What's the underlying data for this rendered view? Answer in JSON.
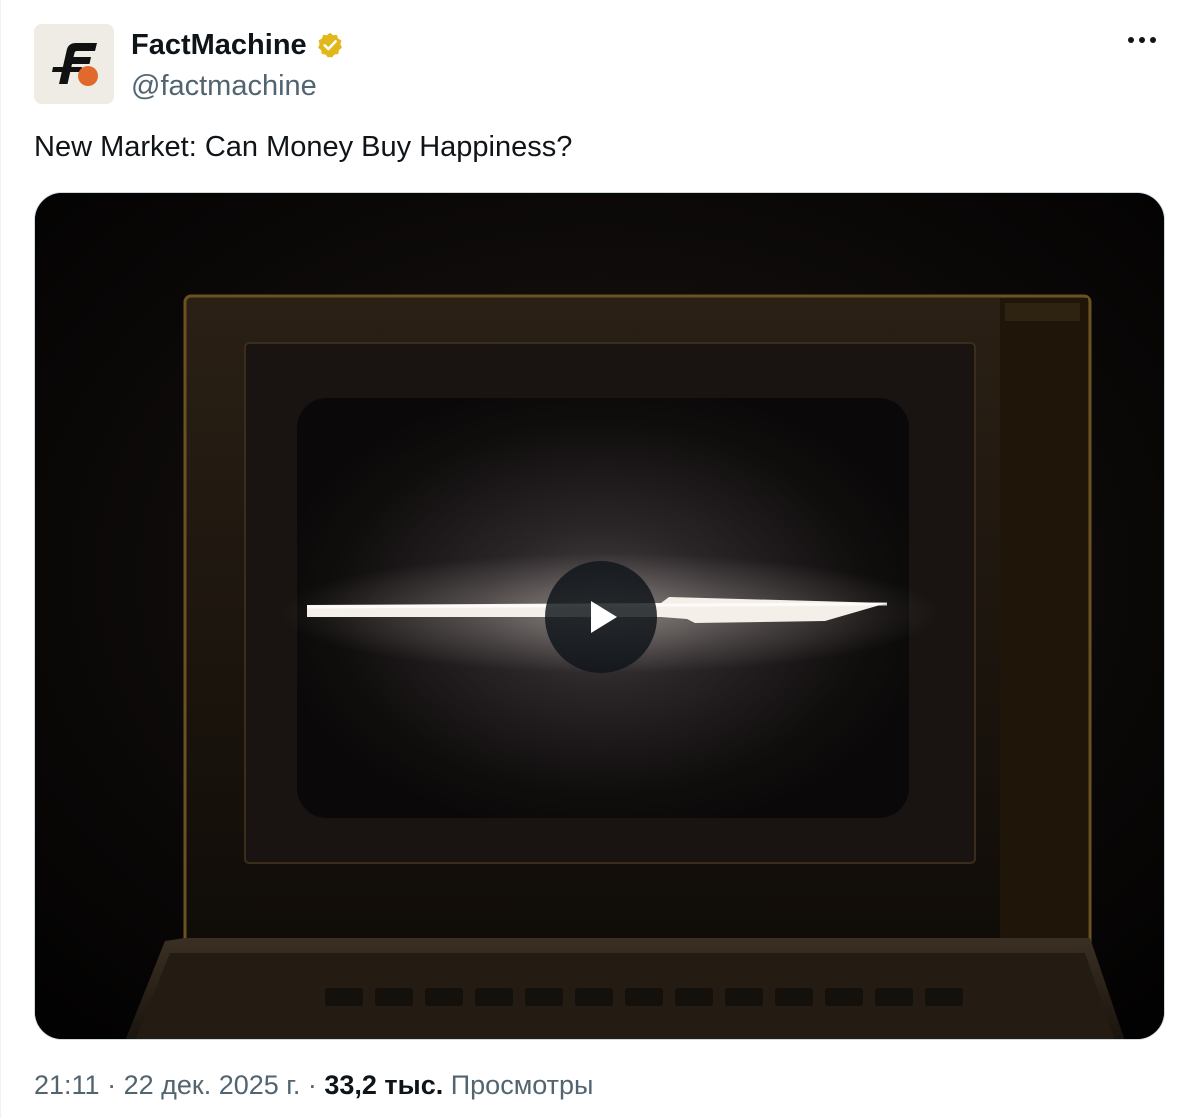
{
  "author": {
    "display_name": "FactMachine",
    "handle": "@factmachine",
    "verified": true,
    "verified_color": "#e2b719",
    "avatar_bg": "#efebe5",
    "avatar_accent": "#e06a2c"
  },
  "tweet": {
    "text": "New Market: Can Money Buy Happiness?"
  },
  "media": {
    "type": "video",
    "has_play_button": true
  },
  "meta": {
    "time": "21:11",
    "separator": "·",
    "date": "22 дек. 2025 г.",
    "views_count": "33,2 тыс.",
    "views_label": "Просмотры"
  },
  "icons": {
    "more": "more-horizontal-icon",
    "verified": "verified-badge-icon",
    "play": "play-icon"
  }
}
